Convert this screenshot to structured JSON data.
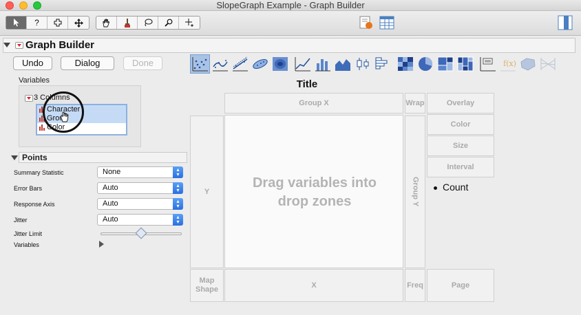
{
  "window": {
    "title": "SlopeGraph Example - Graph Builder"
  },
  "panel": {
    "title": "Graph Builder"
  },
  "buttons": {
    "undo": "Undo",
    "dialog": "Dialog",
    "done": "Done"
  },
  "variables": {
    "label": "Variables",
    "columns_label": "3 Columns",
    "columns": [
      "Character",
      "Group",
      "Color"
    ]
  },
  "points": {
    "header": "Points",
    "summary_statistic": {
      "label": "Summary Statistic",
      "value": "None"
    },
    "error_bars": {
      "label": "Error Bars",
      "value": "Auto"
    },
    "response_axis": {
      "label": "Response Axis",
      "value": "Auto"
    },
    "jitter": {
      "label": "Jitter",
      "value": "Auto"
    },
    "jitter_limit": {
      "label": "Jitter Limit",
      "level": 0.5
    },
    "variables_label": "Variables"
  },
  "graph": {
    "title": "Title",
    "group_x": "Group X",
    "wrap": "Wrap",
    "overlay": "Overlay",
    "color": "Color",
    "size": "Size",
    "interval": "Interval",
    "y": "Y",
    "group_y": "Group Y",
    "drag_msg_line1": "Drag variables into",
    "drag_msg_line2": "drop zones",
    "legend_item": "Count",
    "map_shape_line1": "Map",
    "map_shape_line2": "Shape",
    "x": "X",
    "freq": "Freq",
    "page": "Page"
  },
  "colors": {
    "accent": "#2a6fe0",
    "selected": "#a9c3e6",
    "menu_red": "#d8241f"
  }
}
